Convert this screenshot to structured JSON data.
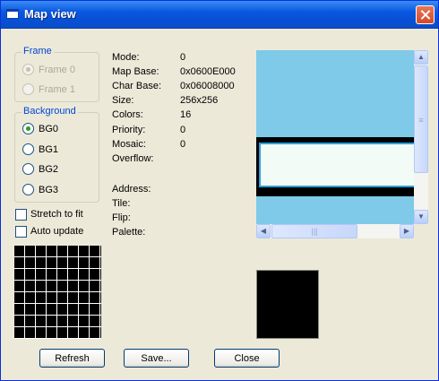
{
  "window": {
    "title": "Map view",
    "title_icon": "window-icon",
    "close_icon": "close-icon"
  },
  "frame_group": {
    "legend": "Frame",
    "options": [
      {
        "label": "Frame 0",
        "selected": true,
        "enabled": false
      },
      {
        "label": "Frame 1",
        "selected": false,
        "enabled": false
      }
    ]
  },
  "background_group": {
    "legend": "Background",
    "options": [
      {
        "label": "BG0",
        "selected": true
      },
      {
        "label": "BG1",
        "selected": false
      },
      {
        "label": "BG2",
        "selected": false
      },
      {
        "label": "BG3",
        "selected": false
      }
    ]
  },
  "checkboxes": [
    {
      "label": "Stretch to fit",
      "checked": false
    },
    {
      "label": "Auto update",
      "checked": false
    }
  ],
  "info": {
    "mode": {
      "label": "Mode:",
      "value": "0"
    },
    "map_base": {
      "label": "Map Base:",
      "value": "0x0600E000"
    },
    "char_base": {
      "label": "Char Base:",
      "value": "0x06008000"
    },
    "size": {
      "label": "Size:",
      "value": "256x256"
    },
    "colors": {
      "label": "Colors:",
      "value": "16"
    },
    "priority": {
      "label": "Priority:",
      "value": "0"
    },
    "mosaic": {
      "label": "Mosaic:",
      "value": "0"
    },
    "overflow": {
      "label": "Overflow:",
      "value": ""
    }
  },
  "tile_info": {
    "address": {
      "label": "Address:",
      "value": ""
    },
    "tile": {
      "label": "Tile:",
      "value": ""
    },
    "flip": {
      "label": "Flip:",
      "value": ""
    },
    "palette": {
      "label": "Palette:",
      "value": ""
    }
  },
  "map_view": {
    "sky_color": "#7ecae8",
    "band_color": "#000000",
    "box_fill": "#f3fbf7",
    "box_border": "#2aa0e0",
    "vertical_scroll": "scrollbar-vertical",
    "horizontal_scroll": "scrollbar-horizontal",
    "up_arrow": "arrow-up-icon",
    "down_arrow": "arrow-down-icon",
    "left_arrow": "arrow-left-icon",
    "right_arrow": "arrow-right-icon"
  },
  "buttons": {
    "refresh": "Refresh",
    "save": "Save...",
    "close": "Close"
  },
  "colors": {
    "titlebar": "#0a58e0",
    "dialog_bg": "#ece9d8",
    "group_legend": "#0046d5",
    "radio_selected": "#21a121"
  }
}
